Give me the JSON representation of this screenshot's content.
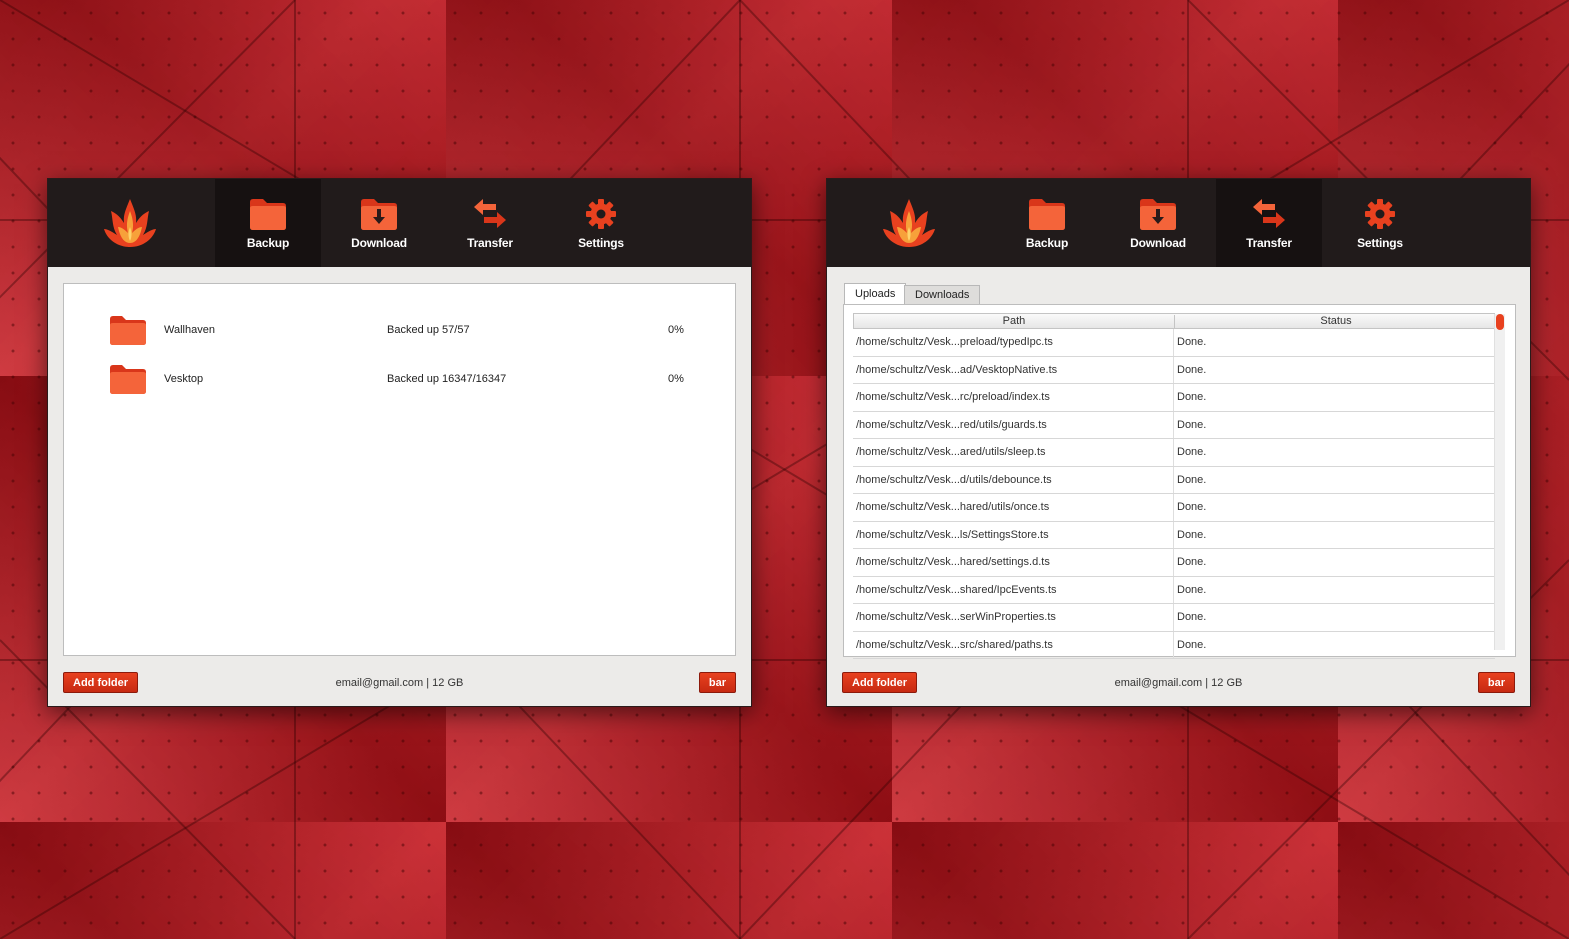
{
  "colors": {
    "accent": "#e8411f",
    "topbar": "#211b1b",
    "topbar_active": "#161111",
    "window_bg": "#ecebe9",
    "wallpaper": "#c4121a"
  },
  "icons": {
    "logo": "flame-lotus-logo-icon",
    "backup": "folder-icon",
    "download": "download-folder-icon",
    "transfer": "transfer-arrows-icon",
    "settings": "gear-icon"
  },
  "nav": {
    "backup": "Backup",
    "download": "Download",
    "transfer": "Transfer",
    "settings": "Settings"
  },
  "left_window": {
    "active_tab": "Backup",
    "folders": [
      {
        "name": "Wallhaven",
        "status": "Backed up 57/57",
        "percent": "0%"
      },
      {
        "name": "Vesktop",
        "status": "Backed up 16347/16347",
        "percent": "0%"
      }
    ]
  },
  "right_window": {
    "active_tab": "Transfer",
    "tabs": {
      "uploads": "Uploads",
      "downloads": "Downloads"
    },
    "columns": {
      "path": "Path",
      "status": "Status"
    },
    "rows": [
      {
        "path": "/home/schultz/Vesk...preload/typedIpc.ts",
        "status": "Done."
      },
      {
        "path": "/home/schultz/Vesk...ad/VesktopNative.ts",
        "status": "Done."
      },
      {
        "path": "/home/schultz/Vesk...rc/preload/index.ts",
        "status": "Done."
      },
      {
        "path": "/home/schultz/Vesk...red/utils/guards.ts",
        "status": "Done."
      },
      {
        "path": "/home/schultz/Vesk...ared/utils/sleep.ts",
        "status": "Done."
      },
      {
        "path": "/home/schultz/Vesk...d/utils/debounce.ts",
        "status": "Done."
      },
      {
        "path": "/home/schultz/Vesk...hared/utils/once.ts",
        "status": "Done."
      },
      {
        "path": "/home/schultz/Vesk...ls/SettingsStore.ts",
        "status": "Done."
      },
      {
        "path": "/home/schultz/Vesk...hared/settings.d.ts",
        "status": "Done."
      },
      {
        "path": "/home/schultz/Vesk...shared/IpcEvents.ts",
        "status": "Done."
      },
      {
        "path": "/home/schultz/Vesk...serWinProperties.ts",
        "status": "Done."
      },
      {
        "path": "/home/schultz/Vesk...src/shared/paths.ts",
        "status": "Done."
      }
    ]
  },
  "footer": {
    "add_folder": "Add folder",
    "account": "email@gmail.com | 12 GB",
    "bar": "bar"
  }
}
